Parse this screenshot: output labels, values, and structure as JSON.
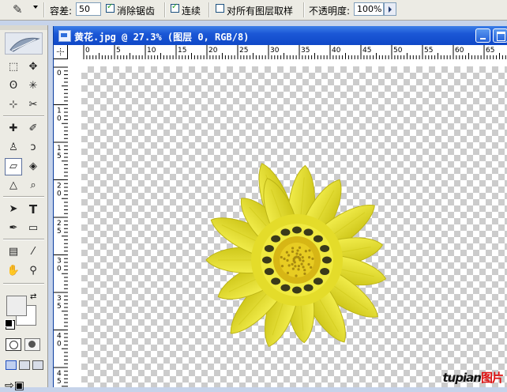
{
  "options": {
    "tolerance_label": "容差:",
    "tolerance_value": "50",
    "antialias_label": "消除锯齿",
    "antialias_checked": true,
    "contiguous_label": "连续",
    "contiguous_checked": true,
    "all_layers_label": "对所有图层取样",
    "all_layers_checked": false,
    "opacity_label": "不透明度:",
    "opacity_value": "100%"
  },
  "document": {
    "title": "黄花.jpg @ 27.3% (图层 0, RGB/8)"
  },
  "ruler_top": [
    "0",
    "5",
    "10",
    "15",
    "20",
    "25",
    "30",
    "35",
    "40",
    "45",
    "50",
    "55",
    "60",
    "65"
  ],
  "ruler_left": [
    "0",
    "1 0",
    "1 5",
    "2 0",
    "2 5",
    "3 0",
    "3 5",
    "4 0",
    "4 5"
  ],
  "watermark": {
    "text": "tupian",
    "tag": "图片"
  },
  "colors": {
    "titlebar": "#1b57d6",
    "flower": "#e8e12a",
    "center": "#d8b818",
    "spots": "#3a3a1a"
  }
}
